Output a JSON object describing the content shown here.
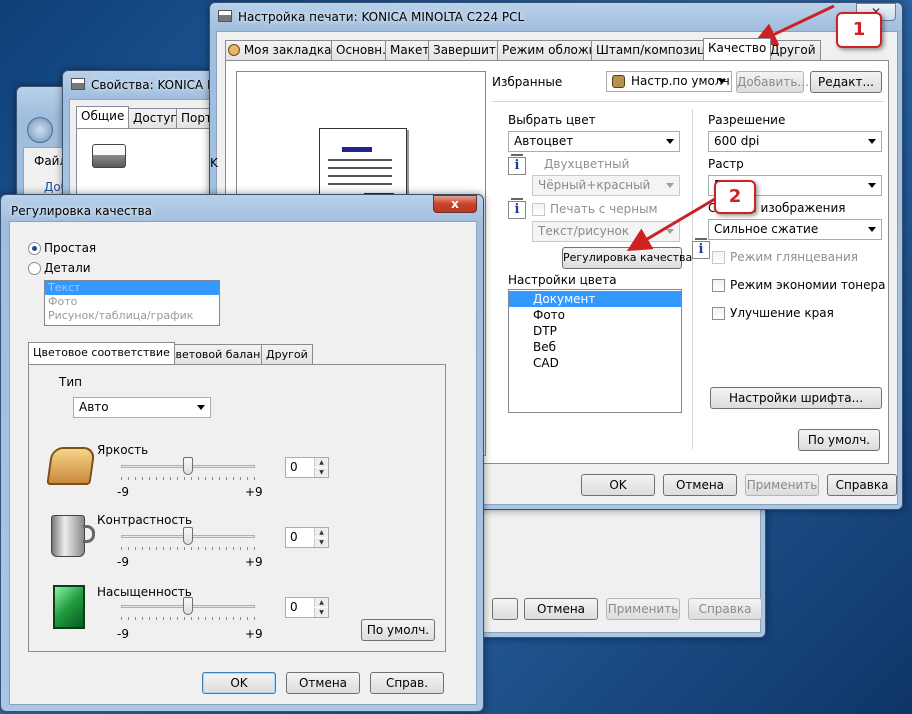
{
  "desktop": {
    "bg_color": "#1d4f86"
  },
  "back_window": {
    "menu": "Файл",
    "link": "Доб",
    "bottom_buttons": [
      "Отмена",
      "Применить",
      "Справка"
    ]
  },
  "props_window": {
    "title": "Свойства: KONICA MI",
    "tabs": [
      "Общие",
      "Доступ",
      "Порты"
    ],
    "name_field_fragment": "K"
  },
  "print_window": {
    "title": "Настройка печати: KONICA MINOLTA C224 PCL",
    "tabs": [
      "Моя закладка",
      "Основн.",
      "Макет",
      "Завершить",
      "Режим обложки",
      "Штамп/композиция",
      "Качество",
      "Другой"
    ],
    "favorites": {
      "label": "Избранные",
      "select": "Настр.по умолч.",
      "add_button": "Добавить...",
      "edit_button": "Редакт..."
    },
    "color": {
      "label": "Выбрать цвет",
      "value": "Автоцвет",
      "two_color_label": "Двухцветный",
      "two_color_value": "Чёрный+красный",
      "print_black_label": "Печать с черным",
      "print_black_value": "Текст/рисунок",
      "quality_button": "Регулировка качества",
      "settings_label": "Настройки цвета",
      "settings_items": [
        "Документ",
        "Фото",
        "DTP",
        "Веб",
        "CAD"
      ],
      "settings_selected": "Документ"
    },
    "resolution": {
      "label": "Разрешение",
      "value": "600 dpi"
    },
    "raster": {
      "label": "Растр",
      "value": "Гр"
    },
    "compression": {
      "label": "Сжатие изображения",
      "value": "Сильное сжатие"
    },
    "gloss_label": "Режим глянцевания",
    "toner_label": "Режим экономии тонера",
    "edge_label": "Улучшение края",
    "font_button": "Настройки шрифта...",
    "default_button": "По умолч.",
    "ok": "OK",
    "cancel": "Отмена",
    "apply": "Применить",
    "help": "Справка"
  },
  "quality_window": {
    "title": "Регулировка качества",
    "close": "x",
    "mode_simple": "Простая",
    "mode_details": "Детали",
    "details_items": [
      "Текст",
      "Фото",
      "Рисунок/таблица/график"
    ],
    "tabs": [
      "Цветовое соответствие",
      "Цветовой баланс",
      "Другой"
    ],
    "type_label": "Тип",
    "type_value": "Авто",
    "sliders": [
      {
        "label": "Яркость",
        "value": "0",
        "min": "-9",
        "max": "+9"
      },
      {
        "label": "Контрастность",
        "value": "0",
        "min": "-9",
        "max": "+9"
      },
      {
        "label": "Насыщенность",
        "value": "0",
        "min": "-9",
        "max": "+9"
      }
    ],
    "default_button": "По умолч.",
    "ok": "OK",
    "cancel": "Отмена",
    "help": "Справ."
  },
  "callouts": [
    "1",
    "2"
  ],
  "accent": "#cc2222"
}
